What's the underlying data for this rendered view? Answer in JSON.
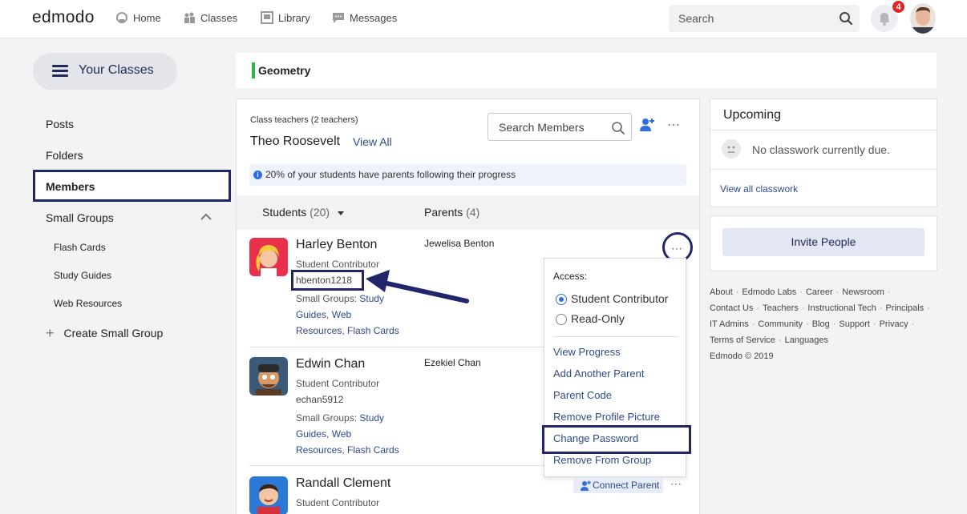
{
  "topbar": {
    "logo": "edmodo",
    "nav": [
      {
        "label": "Home",
        "icon": "home-icon"
      },
      {
        "label": "Classes",
        "icon": "classes-icon"
      },
      {
        "label": "Library",
        "icon": "library-icon"
      },
      {
        "label": "Messages",
        "icon": "messages-icon"
      }
    ],
    "search_placeholder": "Search",
    "notification_count": "4"
  },
  "sidebar": {
    "your_classes": "Your Classes",
    "items": [
      {
        "label": "Posts"
      },
      {
        "label": "Folders"
      },
      {
        "label": "Members"
      },
      {
        "label": "Small Groups"
      }
    ],
    "sub_items": [
      {
        "label": "Flash Cards"
      },
      {
        "label": "Study Guides"
      },
      {
        "label": "Web Resources"
      }
    ],
    "create_group": "Create Small Group"
  },
  "class": {
    "name": "Geometry",
    "accent": "#2db742"
  },
  "members": {
    "teachers_label": "Class teachers (2 teachers)",
    "teacher_name": "Theo Roosevelt",
    "view_all": "View All",
    "search_placeholder": "Search Members",
    "info": "20% of your students have parents following their progress",
    "tabs": {
      "students": "Students",
      "students_count": "(20)",
      "parents": "Parents",
      "parents_count": "(4)"
    },
    "students": [
      {
        "name": "Harley Benton",
        "role": "Student Contributor",
        "username": "hbenton1218",
        "groups_label": "Small Groups:",
        "groups": [
          "Study Guides",
          "Web Resources",
          "Flash Cards"
        ],
        "parent": "Jewelisa Benton"
      },
      {
        "name": "Edwin Chan",
        "role": "Student Contributor",
        "username": "echan5912",
        "groups_label": "Small Groups:",
        "groups": [
          "Study Guides",
          "Web Resources",
          "Flash Cards"
        ],
        "parent": "Ezekiel Chan"
      },
      {
        "name": "Randall Clement",
        "role": "Student Contributor",
        "connect_parent": "Connect Parent"
      }
    ]
  },
  "menu": {
    "access_label": "Access:",
    "options": [
      "Student Contributor",
      "Read-Only"
    ],
    "selected": "Student Contributor",
    "items": [
      "View Progress",
      "Add Another Parent",
      "Parent Code",
      "Remove Profile Picture",
      "Change Password",
      "Remove From Group"
    ]
  },
  "upcoming": {
    "title": "Upcoming",
    "empty": "No classwork currently due.",
    "view_all": "View all classwork"
  },
  "invite": {
    "label": "Invite People"
  },
  "footer": {
    "links": [
      "About",
      "Edmodo Labs",
      "Career",
      "Newsroom",
      "Contact Us",
      "Teachers",
      "Instructional Tech",
      "Principals",
      "IT Admins",
      "Community",
      "Blog",
      "Support",
      "Privacy",
      "Terms of Service",
      "Languages"
    ],
    "copyright": "Edmodo © 2019"
  },
  "colors": {
    "highlight": "#21256a",
    "link": "#2e4a8a",
    "badge": "#e02424"
  }
}
